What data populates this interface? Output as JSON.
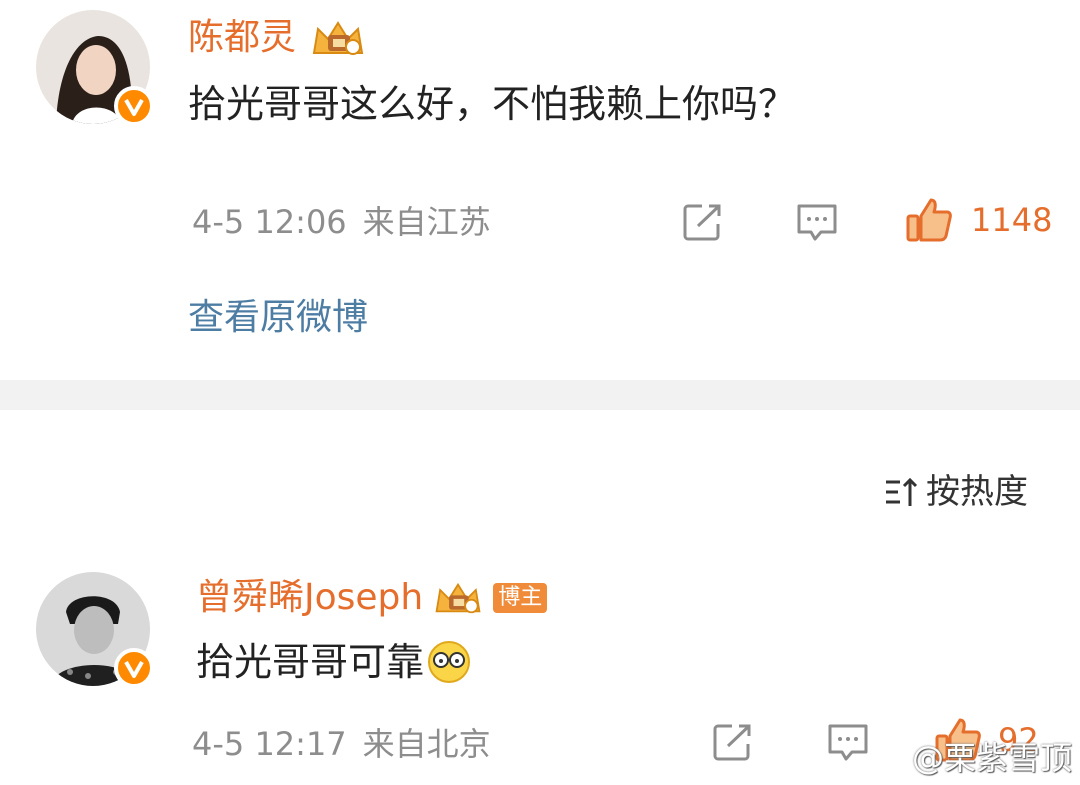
{
  "comments": [
    {
      "username": "陈都灵",
      "text": "拾光哥哥这么好，不怕我赖上你吗？",
      "timestamp": "4-5 12:06",
      "location": "来自江苏",
      "likes": "1148",
      "view_original": "查看原微博"
    },
    {
      "username": "曾舜晞Joseph",
      "tag": "博主",
      "text": "拾光哥哥可靠",
      "timestamp": "4-5 12:17",
      "location": "来自北京",
      "likes": "92"
    }
  ],
  "sort": {
    "label": "按热度"
  },
  "watermark": {
    "text": "@栗紫雪顶"
  },
  "colors": {
    "accent": "#e56e2c",
    "link": "#4d7da3",
    "meta": "#8d8d8d",
    "divider": "#f2f2f2"
  }
}
